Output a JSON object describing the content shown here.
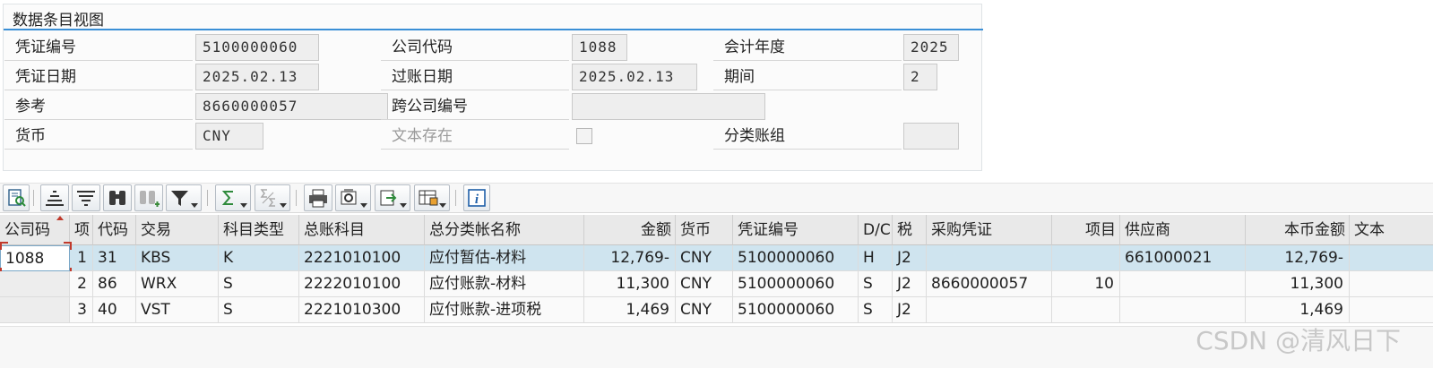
{
  "header": {
    "title": "数据条目视图",
    "doc_no": {
      "label": "凭证编号",
      "value": "5100000060"
    },
    "company_code": {
      "label": "公司代码",
      "value": "1088"
    },
    "fiscal_year": {
      "label": "会计年度",
      "value": "2025"
    },
    "doc_date": {
      "label": "凭证日期",
      "value": "2025.02.13"
    },
    "posting_date": {
      "label": "过账日期",
      "value": "2025.02.13"
    },
    "period": {
      "label": "期间",
      "value": "2"
    },
    "reference": {
      "label": "参考",
      "value": "8660000057"
    },
    "cross_company": {
      "label": "跨公司编号",
      "value": ""
    },
    "currency": {
      "label": "货币",
      "value": "CNY"
    },
    "text_exists": {
      "label": "文本存在",
      "checked": false
    },
    "ledger_group": {
      "label": "分类账组",
      "value": ""
    }
  },
  "toolbar": {
    "icons": [
      "details-icon",
      "sort-ascending-icon",
      "sort-descending-icon",
      "find-icon",
      "find-next-icon",
      "filter-icon",
      "total-icon",
      "subtotal-icon",
      "print-icon",
      "views-icon",
      "export-icon",
      "layout-icon",
      "info-icon"
    ]
  },
  "grid": {
    "columns": [
      "公司码",
      "项",
      "代码",
      "交易",
      "科目类型",
      "总账科目",
      "总分类帐名称",
      "金额",
      "货币",
      "凭证编号",
      "D/C",
      "税",
      "采购凭证",
      "项目",
      "供应商",
      "本币金额",
      "文本"
    ],
    "rows": [
      [
        "1088",
        "1",
        "31",
        "KBS",
        "K",
        "2221010100",
        "应付暂估-材料",
        "12,769-",
        "CNY",
        "5100000060",
        "H",
        "J2",
        "",
        "",
        "661000021",
        "12,769-",
        ""
      ],
      [
        "",
        "2",
        "86",
        "WRX",
        "S",
        "2222010100",
        "应付账款-材料",
        "11,300",
        "CNY",
        "5100000060",
        "S",
        "J2",
        "8660000057",
        "10",
        "",
        "11,300",
        ""
      ],
      [
        "",
        "3",
        "40",
        "VST",
        "S",
        "2221010300",
        "应付账款-进项税",
        "1,469",
        "CNY",
        "5100000060",
        "S",
        "J2",
        "",
        "",
        "",
        "1,469",
        ""
      ]
    ]
  },
  "watermark": "CSDN @清风日下",
  "colors": {
    "accent": "#3a8fd6",
    "selected_row": "#cfe4ef",
    "header_bg": "#e9e9e9"
  }
}
